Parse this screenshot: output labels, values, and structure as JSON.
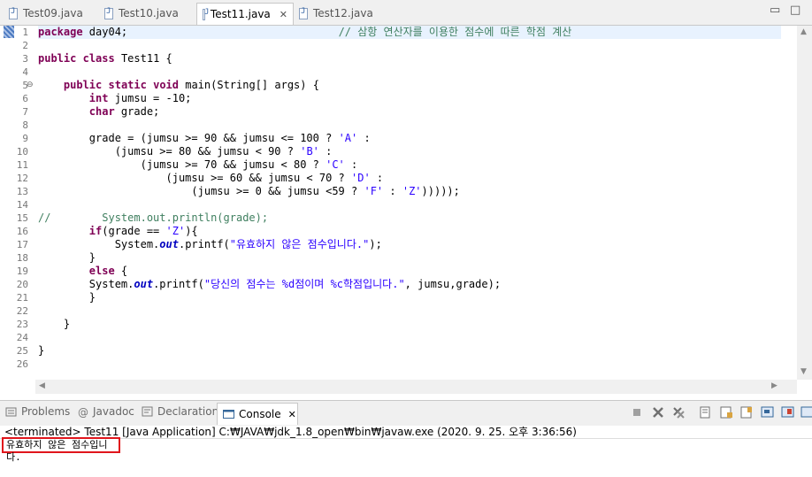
{
  "editor_tabs": [
    {
      "label": "Test09.java"
    },
    {
      "label": "Test10.java"
    },
    {
      "label": "Test11.java"
    },
    {
      "label": "Test12.java"
    }
  ],
  "tab_close_glyph": "✕",
  "window_controls": {
    "minimize": "▭",
    "maximize": "□"
  },
  "line_numbers": [
    "1",
    "2",
    "3",
    "4",
    "5",
    "6",
    "7",
    "8",
    "9",
    "10",
    "11",
    "12",
    "13",
    "14",
    "15",
    "16",
    "17",
    "18",
    "19",
    "20",
    "21",
    "22",
    "23",
    "24",
    "25",
    "26"
  ],
  "code_lines": [
    [
      {
        "t": "kw",
        "s": "package"
      },
      {
        "t": "",
        "s": " day04;                                 "
      },
      {
        "t": "cm",
        "s": "// 삼항 연산자를 이용한 점수에 따른 학점 계산"
      }
    ],
    [],
    [
      {
        "t": "kw",
        "s": "public"
      },
      {
        "t": "",
        "s": " "
      },
      {
        "t": "kw",
        "s": "class"
      },
      {
        "t": "",
        "s": " Test11 {"
      }
    ],
    [],
    [
      {
        "t": "",
        "s": "    "
      },
      {
        "t": "kw",
        "s": "public"
      },
      {
        "t": "",
        "s": " "
      },
      {
        "t": "kw",
        "s": "static"
      },
      {
        "t": "",
        "s": " "
      },
      {
        "t": "kw",
        "s": "void"
      },
      {
        "t": "",
        "s": " main(String[] args) {"
      }
    ],
    [
      {
        "t": "",
        "s": "        "
      },
      {
        "t": "kw",
        "s": "int"
      },
      {
        "t": "",
        "s": " jumsu = -10;"
      }
    ],
    [
      {
        "t": "",
        "s": "        "
      },
      {
        "t": "kw",
        "s": "char"
      },
      {
        "t": "",
        "s": " grade;"
      }
    ],
    [],
    [
      {
        "t": "",
        "s": "        grade = (jumsu >= 90 && jumsu <= 100 ? "
      },
      {
        "t": "str",
        "s": "'A'"
      },
      {
        "t": "",
        "s": " :"
      }
    ],
    [
      {
        "t": "",
        "s": "            (jumsu >= 80 && jumsu < 90 ? "
      },
      {
        "t": "str",
        "s": "'B'"
      },
      {
        "t": "",
        "s": " :"
      }
    ],
    [
      {
        "t": "",
        "s": "                (jumsu >= 70 && jumsu < 80 ? "
      },
      {
        "t": "str",
        "s": "'C'"
      },
      {
        "t": "",
        "s": " :"
      }
    ],
    [
      {
        "t": "",
        "s": "                    (jumsu >= 60 && jumsu < 70 ? "
      },
      {
        "t": "str",
        "s": "'D'"
      },
      {
        "t": "",
        "s": " :"
      }
    ],
    [
      {
        "t": "",
        "s": "                        (jumsu >= 0 && jumsu <59 ? "
      },
      {
        "t": "str",
        "s": "'F'"
      },
      {
        "t": "",
        "s": " : "
      },
      {
        "t": "str",
        "s": "'Z'"
      },
      {
        "t": "",
        "s": ")))));"
      }
    ],
    [],
    [
      {
        "t": "cm",
        "s": "//        System.out.println(grade);"
      }
    ],
    [
      {
        "t": "",
        "s": "        "
      },
      {
        "t": "kw",
        "s": "if"
      },
      {
        "t": "",
        "s": "(grade == "
      },
      {
        "t": "str",
        "s": "'Z'"
      },
      {
        "t": "",
        "s": "){"
      }
    ],
    [
      {
        "t": "",
        "s": "            System."
      },
      {
        "t": "it",
        "s": "out"
      },
      {
        "t": "",
        "s": ".printf("
      },
      {
        "t": "str",
        "s": "\"유효하지 않은 점수입니다.\""
      },
      {
        "t": "",
        "s": ");"
      }
    ],
    [
      {
        "t": "",
        "s": "        }"
      }
    ],
    [
      {
        "t": "",
        "s": "        "
      },
      {
        "t": "kw",
        "s": "else"
      },
      {
        "t": "",
        "s": " {"
      }
    ],
    [
      {
        "t": "",
        "s": "        System."
      },
      {
        "t": "it",
        "s": "out"
      },
      {
        "t": "",
        "s": ".printf("
      },
      {
        "t": "str",
        "s": "\"당신의 점수는 %d점이며 %c학점입니다.\""
      },
      {
        "t": "",
        "s": ", jumsu,grade);"
      }
    ],
    [
      {
        "t": "",
        "s": "        }"
      }
    ],
    [],
    [
      {
        "t": "",
        "s": "    }"
      }
    ],
    [],
    [
      {
        "t": "",
        "s": "}"
      }
    ],
    []
  ],
  "console_tabs": [
    {
      "label": "Problems"
    },
    {
      "label": "Javadoc"
    },
    {
      "label": "Declaration"
    },
    {
      "label": "Console"
    }
  ],
  "console": {
    "terminated": "<terminated> Test11 [Java Application] C:₩JAVA₩jdk_1.8_open₩bin₩javaw.exe (2020. 9. 25. 오후 3:36:56)",
    "output": "유효하지 않은 점수입니다."
  },
  "colors": {
    "keyword": "#7f0055",
    "string": "#2a00ff",
    "comment": "#3f7f5f",
    "highlight": "#e0161c"
  }
}
